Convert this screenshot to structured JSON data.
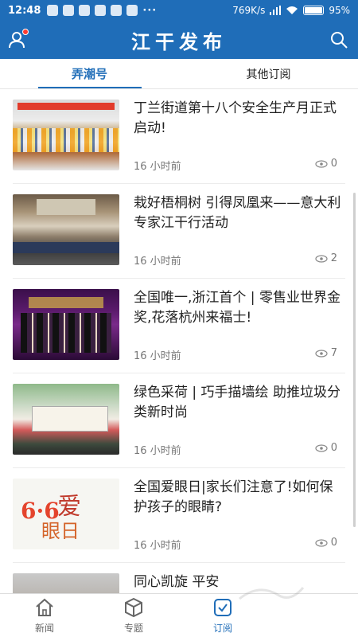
{
  "status_bar": {
    "time": "12:48",
    "dots": "···",
    "net_speed": "769K/s",
    "battery": "95%"
  },
  "header": {
    "title": "江干发布"
  },
  "tabs": [
    {
      "label": "弄潮号",
      "active": true
    },
    {
      "label": "其他订阅",
      "active": false
    }
  ],
  "news": [
    {
      "title": "丁兰街道第十八个安全生产月正式启动!",
      "time": "16 小时前",
      "views": "0"
    },
    {
      "title": "栽好梧桐树 引得凤凰来——意大利专家江干行活动",
      "time": "16 小时前",
      "views": "2"
    },
    {
      "title": "全国唯一,浙江首个 | 零售业世界金奖,花落杭州来福士!",
      "time": "16 小时前",
      "views": "7"
    },
    {
      "title": "绿色采荷 | 巧手描墙绘 助推垃圾分类新时尚",
      "time": "16 小时前",
      "views": "0"
    },
    {
      "title": "全国爱眼日|家长们注意了!如何保护孩子的眼睛?",
      "time": "16 小时前",
      "views": "0"
    },
    {
      "title": "同心凯旋 平安",
      "time": "",
      "views": ""
    }
  ],
  "thumb5_text": {
    "num": "6·6",
    "hz1": "爱",
    "hz2": "眼日"
  },
  "bottom_nav": [
    {
      "label": "新闻",
      "icon": "home-icon",
      "active": false
    },
    {
      "label": "专题",
      "icon": "cube-icon",
      "active": false
    },
    {
      "label": "订阅",
      "icon": "subscribe-check-icon",
      "active": true
    }
  ],
  "colors": {
    "brand": "#1f6db8",
    "header_text": "#ffffff"
  }
}
